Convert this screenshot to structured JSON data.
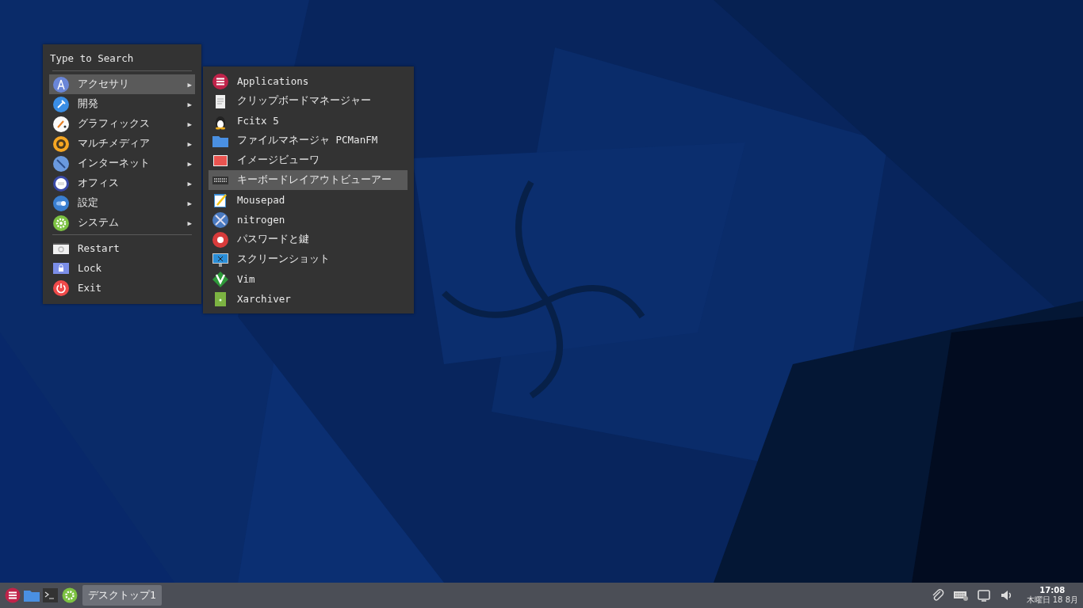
{
  "main_menu": {
    "search": {
      "placeholder": "Type to Search"
    },
    "categories": [
      {
        "label": "アクセサリ",
        "selected": true,
        "arrow": "▶"
      },
      {
        "label": "開発",
        "selected": false,
        "arrow": "▶"
      },
      {
        "label": "グラフィックス",
        "selected": false,
        "arrow": "▶"
      },
      {
        "label": "マルチメディア",
        "selected": false,
        "arrow": "▶"
      },
      {
        "label": "インターネット",
        "selected": false,
        "arrow": "▶"
      },
      {
        "label": "オフィス",
        "selected": false,
        "arrow": "▶"
      },
      {
        "label": "設定",
        "selected": false,
        "arrow": "▶"
      },
      {
        "label": "システム",
        "selected": false,
        "arrow": "▶"
      }
    ],
    "actions": [
      {
        "label": "Restart"
      },
      {
        "label": "Lock"
      },
      {
        "label": "Exit"
      }
    ]
  },
  "submenu": {
    "items": [
      {
        "label": "Applications",
        "selected": false
      },
      {
        "label": "クリップボードマネージャー",
        "selected": false
      },
      {
        "label": "Fcitx 5",
        "selected": false
      },
      {
        "label": "ファイルマネージャ PCManFM",
        "selected": false
      },
      {
        "label": "イメージビューワ",
        "selected": false
      },
      {
        "label": "キーボードレイアウトビューアー",
        "selected": true
      },
      {
        "label": "Mousepad",
        "selected": false
      },
      {
        "label": "nitrogen",
        "selected": false
      },
      {
        "label": "パスワードと鍵",
        "selected": false
      },
      {
        "label": "スクリーンショット",
        "selected": false
      },
      {
        "label": "Vim",
        "selected": false
      },
      {
        "label": "Xarchiver",
        "selected": false
      }
    ]
  },
  "taskbar": {
    "tasks": [
      {
        "label": "デスクトップ1",
        "selected": true
      }
    ],
    "clock": {
      "time": "17:08",
      "date": "木曜日 18 8月"
    }
  }
}
